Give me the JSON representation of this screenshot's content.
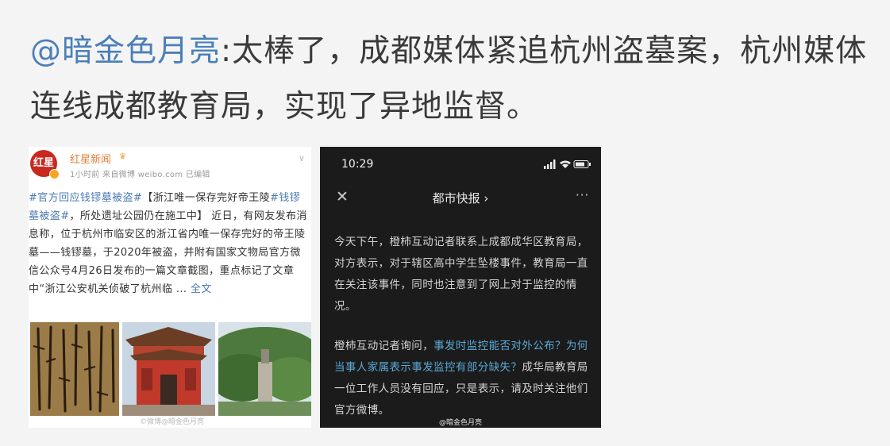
{
  "post": {
    "mention": "@暗金色月亮",
    "text": ":太棒了，成都媒体紧追杭州盗墓案，杭州媒体连线成都教育局，实现了异地监督。"
  },
  "left_shot": {
    "avatar_text": "红星",
    "account_name": "红星新闻",
    "meta": "1小时前  来自微博 weibo.com  已编辑",
    "topic1": "#官方回应钱镠墓被盗#",
    "text1": "【浙江唯一保存完好帝王陵",
    "topic2": "#钱镠墓被盗#",
    "text2": "，所处遗址公园仍在施工中】 近日，有网友发布消息称，位于杭州市临安区的浙江省内唯一保存完好的帝王陵墓——钱镠墓，于2020年被盗，并附有国家文物局官方微信公众号4月26日发布的一篇文章截图，重点标记了文章中“浙江公安机关侦破了杭州临 ... ",
    "more": "全文",
    "watermark": "©微博@暗金色月亮"
  },
  "right_shot": {
    "time": "10:29",
    "title": "都市快报 ›",
    "close": "✕",
    "more": "···",
    "para1": "今天下午，橙柿互动记者联系上成都成华区教育局，对方表示，对于辖区高中学生坠楼事件，教育局一直在关注该事件，同时也注意到了网上对于监控的情况。",
    "para2_a": "橙柿互动记者询问，",
    "para2_hl": "事发时监控能否对外公布？为何当事人家属表示事发监控有部分缺失？",
    "para2_b": "成华局教育局一位工作人员没有回应，只是表示，请及时关注他们官方微博。",
    "watermark": "@暗金色月亮"
  }
}
